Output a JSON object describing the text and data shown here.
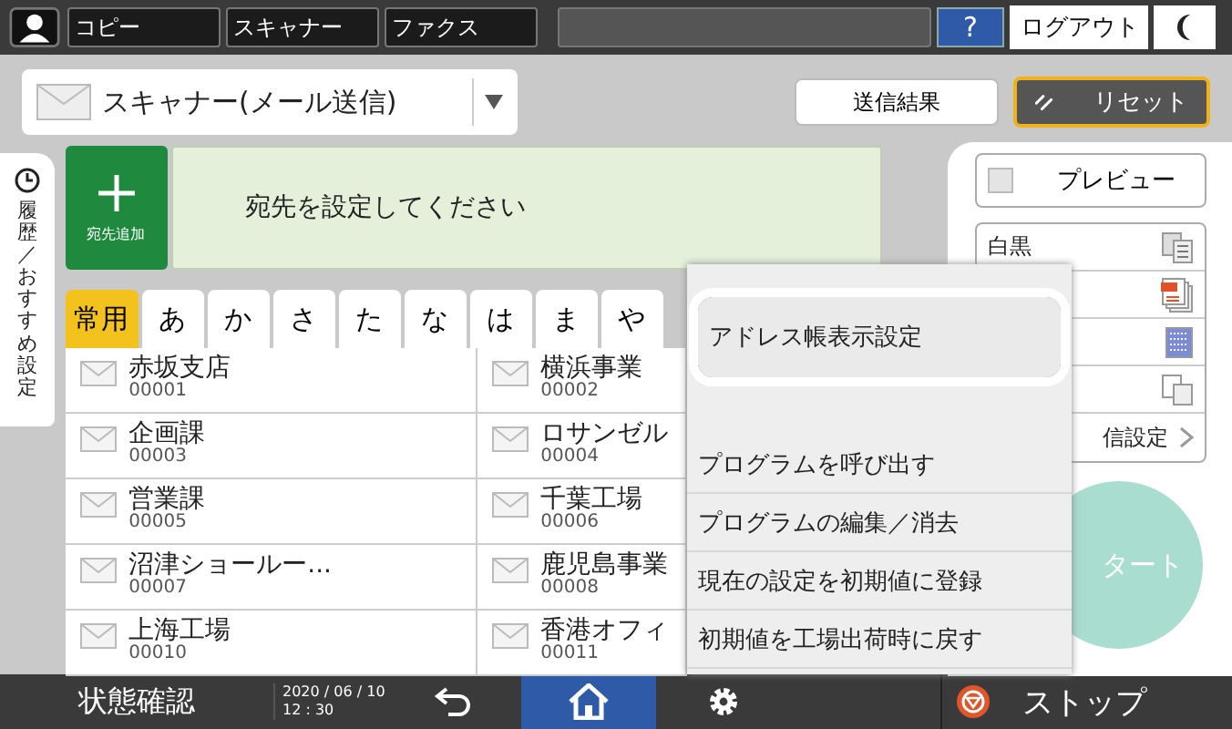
{
  "top_bar": {
    "apps": [
      "コピー",
      "スキャナー",
      "ファクス"
    ],
    "help": "?",
    "logout": "ログアウト"
  },
  "mode_selector": {
    "label": "スキャナー(メール送信)"
  },
  "header_buttons": {
    "send_result": "送信結果",
    "reset": "リセット"
  },
  "side_tab": {
    "label": "履歴／おすすめ設定"
  },
  "add_button": {
    "label": "宛先追加"
  },
  "prompt": "宛先を設定してください",
  "index_tabs": [
    {
      "label": "常用",
      "selected": true
    },
    {
      "label": "あ",
      "selected": false
    },
    {
      "label": "か",
      "selected": false
    },
    {
      "label": "さ",
      "selected": false
    },
    {
      "label": "た",
      "selected": false
    },
    {
      "label": "な",
      "selected": false
    },
    {
      "label": "は",
      "selected": false
    },
    {
      "label": "ま",
      "selected": false
    },
    {
      "label": "や",
      "selected": false
    }
  ],
  "entries": [
    {
      "name": "赤坂支店",
      "number": "00001"
    },
    {
      "name": "横浜事業",
      "number": "00002"
    },
    {
      "name": "企画課",
      "number": "00003"
    },
    {
      "name": "ロサンゼル",
      "number": "00004"
    },
    {
      "name": "営業課",
      "number": "00005"
    },
    {
      "name": "千葉工場",
      "number": "00006"
    },
    {
      "name": "沼津ショールー...",
      "number": "00007"
    },
    {
      "name": "鹿児島事業",
      "number": "00008"
    },
    {
      "name": "上海工場",
      "number": "00010"
    },
    {
      "name": "香港オフィ",
      "number": "00011"
    }
  ],
  "right_panel": {
    "preview": {
      "label": "プレビュー",
      "checked": false
    },
    "settings": [
      {
        "kind": "color",
        "label": "白黒"
      },
      {
        "kind": "file"
      },
      {
        "kind": "resolution"
      },
      {
        "kind": "pages"
      }
    ],
    "more_settings": "信設定",
    "start": "タート"
  },
  "menu": {
    "items": [
      {
        "label": "アドレス帳表示設定",
        "selected": true
      },
      {
        "label": "プログラムを呼び出す",
        "selected": false
      },
      {
        "label": "プログラムの編集／消去",
        "selected": false
      },
      {
        "label": "現在の設定を初期値に登録",
        "selected": false
      },
      {
        "label": "初期値を工場出荷時に戻す",
        "selected": false
      }
    ]
  },
  "bottom_bar": {
    "status": "状態確認",
    "date": "2020 / 06 / 10",
    "time": "12 : 30",
    "nav": [
      {
        "kind": "back",
        "selected": false
      },
      {
        "kind": "home",
        "selected": true
      },
      {
        "kind": "settings",
        "selected": false
      }
    ],
    "stop": "ストップ"
  }
}
